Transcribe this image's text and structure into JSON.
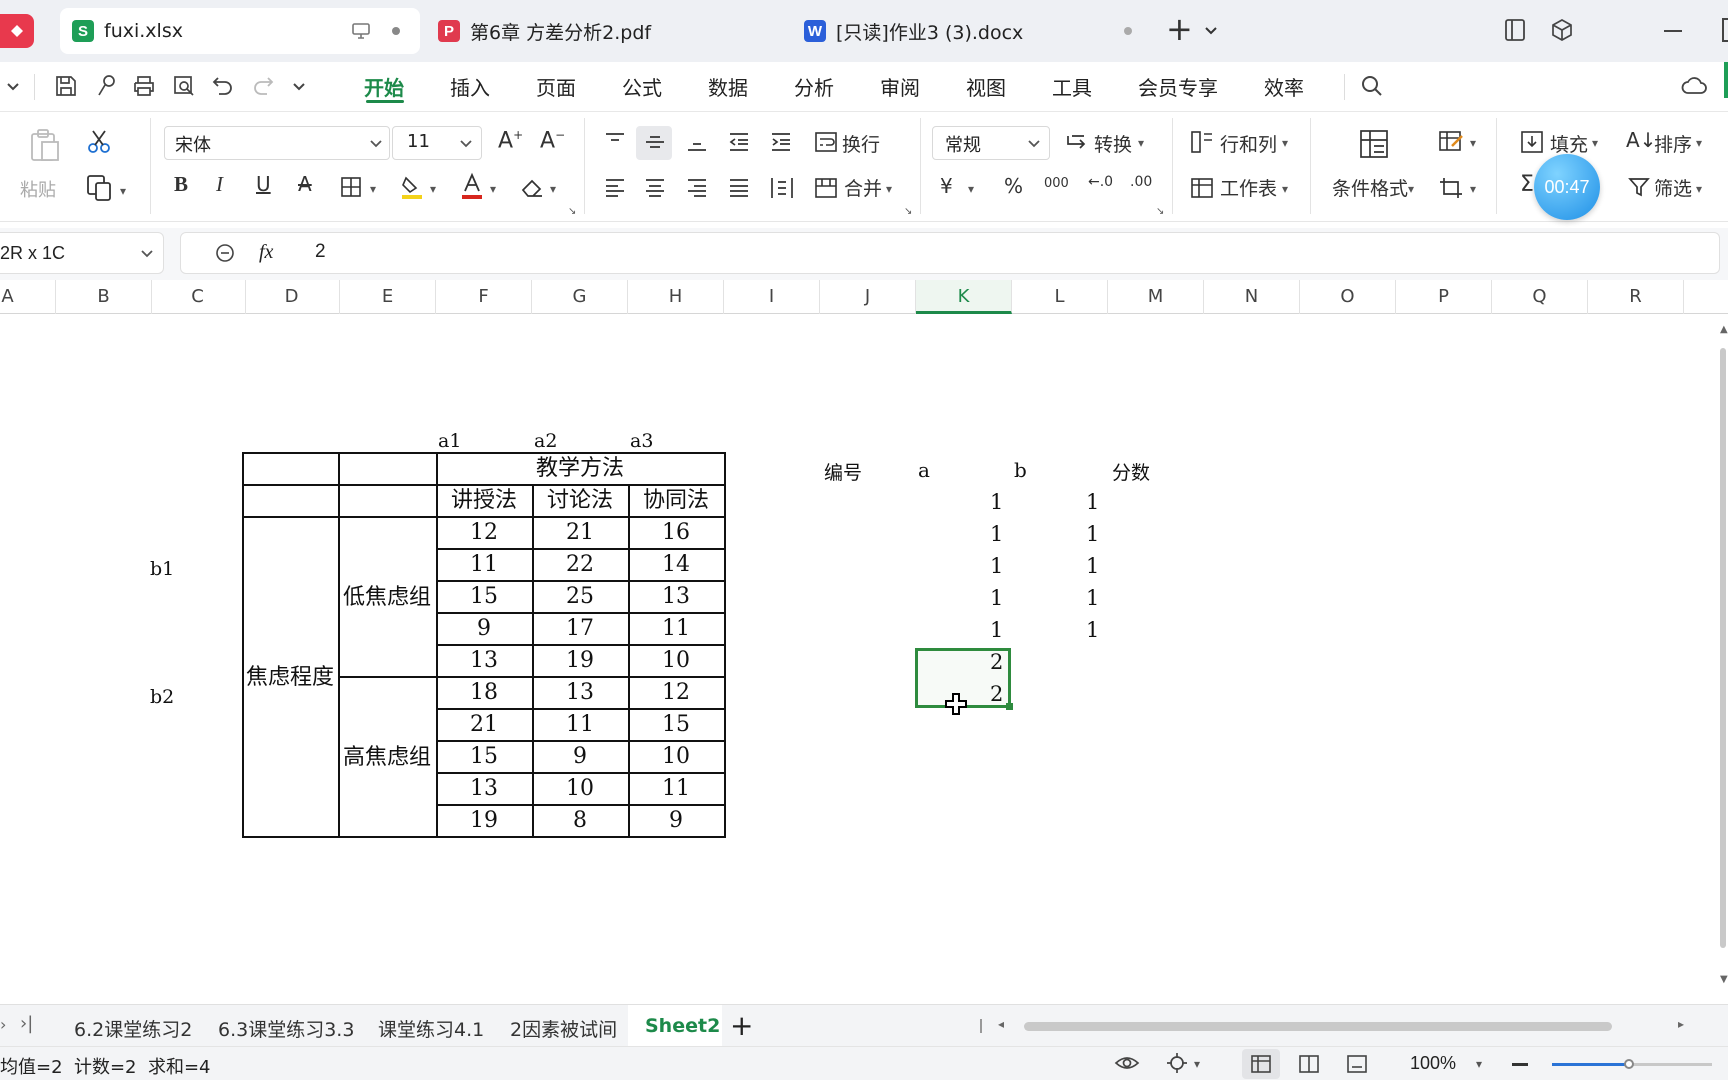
{
  "titlebar": {
    "tabs": [
      {
        "label": "fuxi.xlsx",
        "app": "S",
        "color": "#1e9e57"
      },
      {
        "label": "第6章 方差分析2.pdf",
        "app": "P",
        "color": "#e03a4e"
      },
      {
        "label": "[只读]作业3 (3).docx",
        "app": "W",
        "color": "#2b5fd9"
      }
    ],
    "new_tab": "+"
  },
  "menu": {
    "items": [
      "开始",
      "插入",
      "页面",
      "公式",
      "数据",
      "分析",
      "审阅",
      "视图",
      "工具",
      "会员专享",
      "效率"
    ],
    "active": "开始"
  },
  "ribbon": {
    "paste": "粘贴",
    "font_name": "宋体",
    "font_size": "11",
    "wrap": "换行",
    "merge": "合并",
    "number_format": "常规",
    "convert": "转换",
    "rows_cols": "行和列",
    "worksheet": "工作表",
    "conditional_format": "条件格式",
    "fill": "填充",
    "sort": "排序",
    "filter": "筛选",
    "currency": "¥",
    "percent": "%",
    "thousands": "000",
    "timer": "00:47"
  },
  "formula_bar": {
    "name_box": "2R x 1C",
    "fx": "fx",
    "value": "2"
  },
  "columns": [
    "A",
    "B",
    "C",
    "D",
    "E",
    "F",
    "G",
    "H",
    "I",
    "J",
    "K",
    "L",
    "M",
    "N",
    "O",
    "P",
    "Q",
    "R"
  ],
  "selected_column": "K",
  "sheet": {
    "labels": {
      "a1": "a1",
      "a2": "a2",
      "a3": "a3",
      "b1": "b1",
      "b2": "b2"
    },
    "table": {
      "header_method": "教学方法",
      "methods": [
        "讲授法",
        "讨论法",
        "协同法"
      ],
      "factor": "焦虑程度",
      "groups": [
        "低焦虑组",
        "高焦虑组"
      ],
      "rows": [
        [
          12,
          21,
          16
        ],
        [
          11,
          22,
          14
        ],
        [
          15,
          25,
          13
        ],
        [
          9,
          17,
          11
        ],
        [
          13,
          19,
          10
        ],
        [
          18,
          13,
          12
        ],
        [
          21,
          11,
          15
        ],
        [
          15,
          9,
          10
        ],
        [
          13,
          10,
          11
        ],
        [
          19,
          8,
          9
        ]
      ]
    },
    "right_headers": {
      "id": "编号",
      "a": "a",
      "b": "b",
      "score": "分数"
    },
    "k_values": [
      "1",
      "1",
      "1",
      "1",
      "1",
      "2",
      "2"
    ],
    "l_values": [
      "1",
      "1",
      "1",
      "1",
      "1"
    ]
  },
  "sheet_tabs": [
    "6.2课堂练习2",
    "6.3课堂练习3.3",
    "课堂练习4.1",
    "2因素被试间",
    "Sheet2"
  ],
  "active_sheet": "Sheet2",
  "status": {
    "summary": "均值=2  计数=2  求和=4",
    "zoom": "100%"
  }
}
